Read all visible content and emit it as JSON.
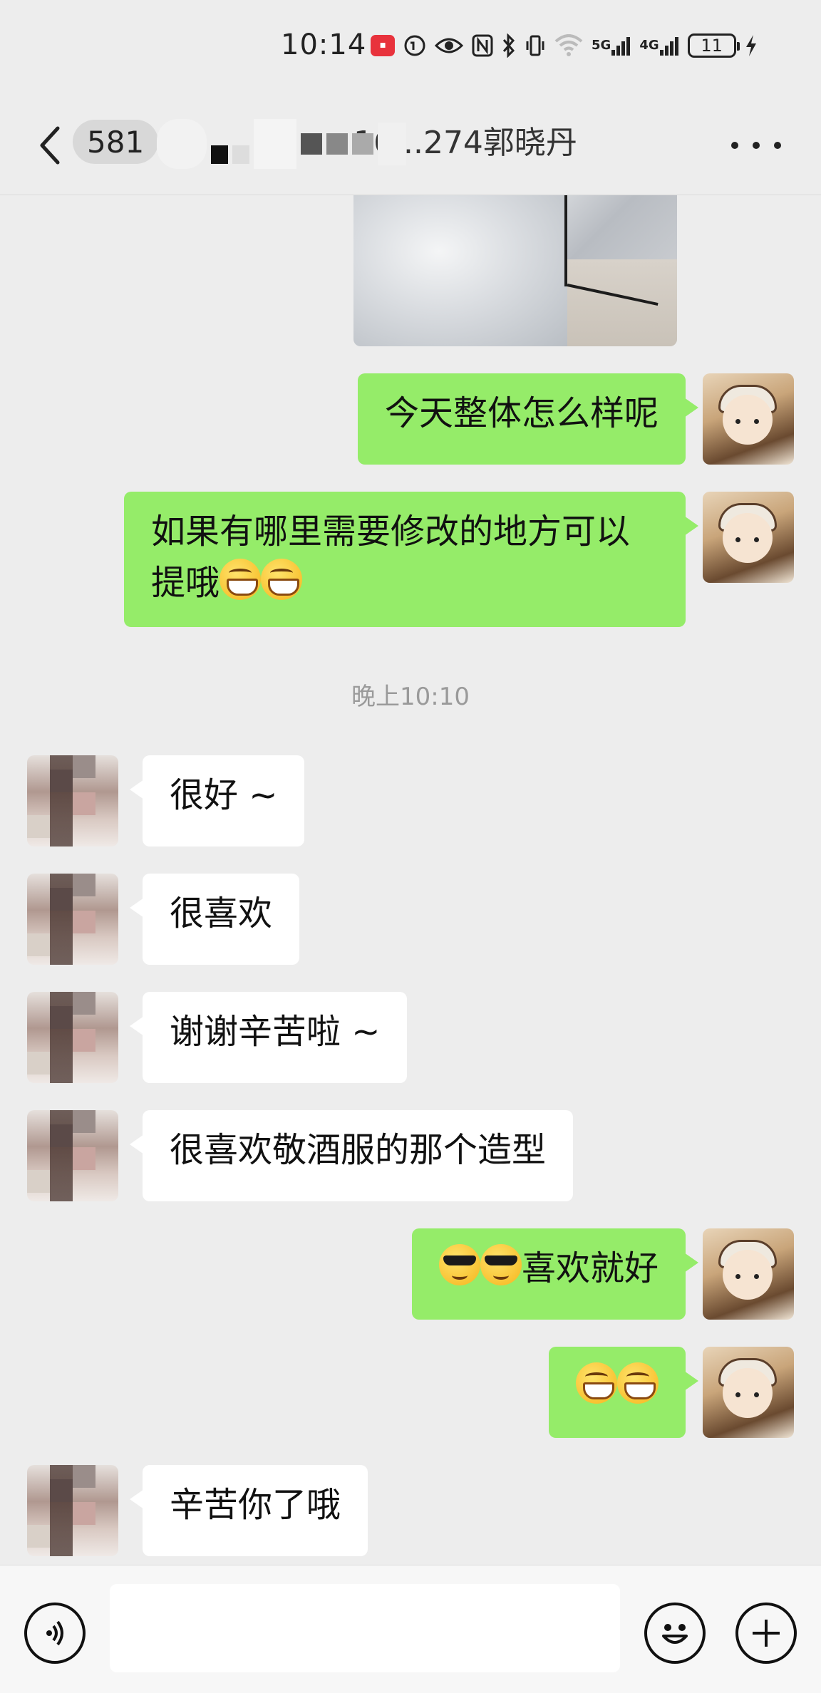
{
  "status_bar": {
    "time": "10:14",
    "network_5g": "5G",
    "network_4g": "4G",
    "battery": "11"
  },
  "header": {
    "unread_count": "581",
    "title": "16...274郭晓丹"
  },
  "messages": [
    {
      "side": "me",
      "text": "今天整体怎么样呢"
    },
    {
      "side": "me",
      "text": "如果有哪里需要修改的地方可以提哦"
    },
    {
      "side": "other",
      "text": "很好 ~"
    },
    {
      "side": "other",
      "text": "很喜欢"
    },
    {
      "side": "other",
      "text": "谢谢辛苦啦 ~"
    },
    {
      "side": "other",
      "text": "很喜欢敬酒服的那个造型"
    },
    {
      "side": "me",
      "text": "喜欢就好"
    },
    {
      "side": "other",
      "text": "辛苦你了哦"
    }
  ],
  "timestamp": "晚上10:10",
  "input": {
    "value": ""
  }
}
